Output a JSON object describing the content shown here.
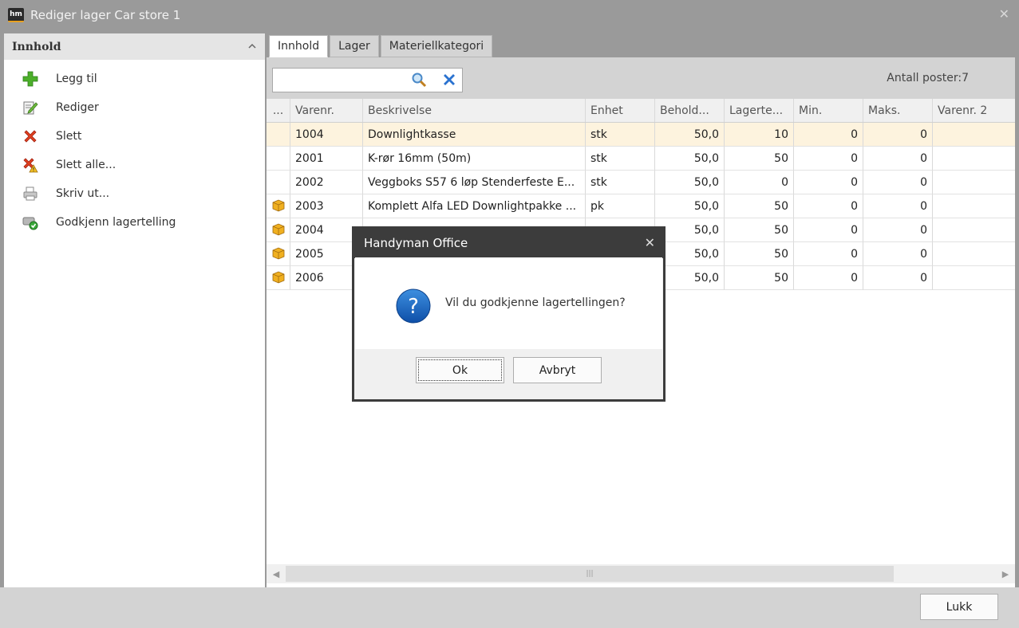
{
  "window": {
    "logo": "hm",
    "title": "Rediger lager Car store 1",
    "close": "✕"
  },
  "sidebar": {
    "title": "Innhold",
    "items": [
      {
        "label": "Legg til",
        "icon": "plus-icon"
      },
      {
        "label": "Rediger",
        "icon": "edit-icon"
      },
      {
        "label": "Slett",
        "icon": "delete-icon"
      },
      {
        "label": "Slett alle...",
        "icon": "delete-all-icon"
      },
      {
        "label": "Skriv ut...",
        "icon": "printer-icon"
      },
      {
        "label": "Godkjenn lagertelling",
        "icon": "approve-icon"
      }
    ]
  },
  "tabs": [
    {
      "label": "Innhold",
      "active": true
    },
    {
      "label": "Lager",
      "active": false
    },
    {
      "label": "Materiellkategori",
      "active": false
    }
  ],
  "search": {
    "value": "",
    "count_label": "Antall poster:7"
  },
  "grid": {
    "columns": [
      "...",
      "Varenr.",
      "Beskrivelse",
      "Enhet",
      "Behold...",
      "Lagerte...",
      "Min.",
      "Maks.",
      "Varenr. 2"
    ],
    "rows": [
      {
        "icon": false,
        "varenr": "1004",
        "beskrivelse": "Downlightkasse",
        "enhet": "stk",
        "behold": "50,0",
        "lagerte": "10",
        "min": "0",
        "maks": "0",
        "varenr2": ""
      },
      {
        "icon": false,
        "varenr": "2001",
        "beskrivelse": "K-rør 16mm (50m)",
        "enhet": "stk",
        "behold": "50,0",
        "lagerte": "50",
        "min": "0",
        "maks": "0",
        "varenr2": ""
      },
      {
        "icon": false,
        "varenr": "2002",
        "beskrivelse": "Veggboks S57 6 løp Stenderfeste E...",
        "enhet": "stk",
        "behold": "50,0",
        "lagerte": "0",
        "min": "0",
        "maks": "0",
        "varenr2": ""
      },
      {
        "icon": true,
        "varenr": "2003",
        "beskrivelse": "Komplett Alfa LED Downlightpakke ...",
        "enhet": "pk",
        "behold": "50,0",
        "lagerte": "50",
        "min": "0",
        "maks": "0",
        "varenr2": ""
      },
      {
        "icon": true,
        "varenr": "2004",
        "beskrivelse": "",
        "enhet": "",
        "behold": "50,0",
        "lagerte": "50",
        "min": "0",
        "maks": "0",
        "varenr2": ""
      },
      {
        "icon": true,
        "varenr": "2005",
        "beskrivelse": "",
        "enhet": "",
        "behold": "50,0",
        "lagerte": "50",
        "min": "0",
        "maks": "0",
        "varenr2": ""
      },
      {
        "icon": true,
        "varenr": "2006",
        "beskrivelse": "",
        "enhet": "",
        "behold": "50,0",
        "lagerte": "50",
        "min": "0",
        "maks": "0",
        "varenr2": ""
      }
    ]
  },
  "footer": {
    "close_label": "Lukk"
  },
  "dialog": {
    "title": "Handyman Office",
    "close": "✕",
    "message": "Vil du godkjenne lagertellingen?",
    "ok_label": "Ok",
    "cancel_label": "Avbryt"
  }
}
